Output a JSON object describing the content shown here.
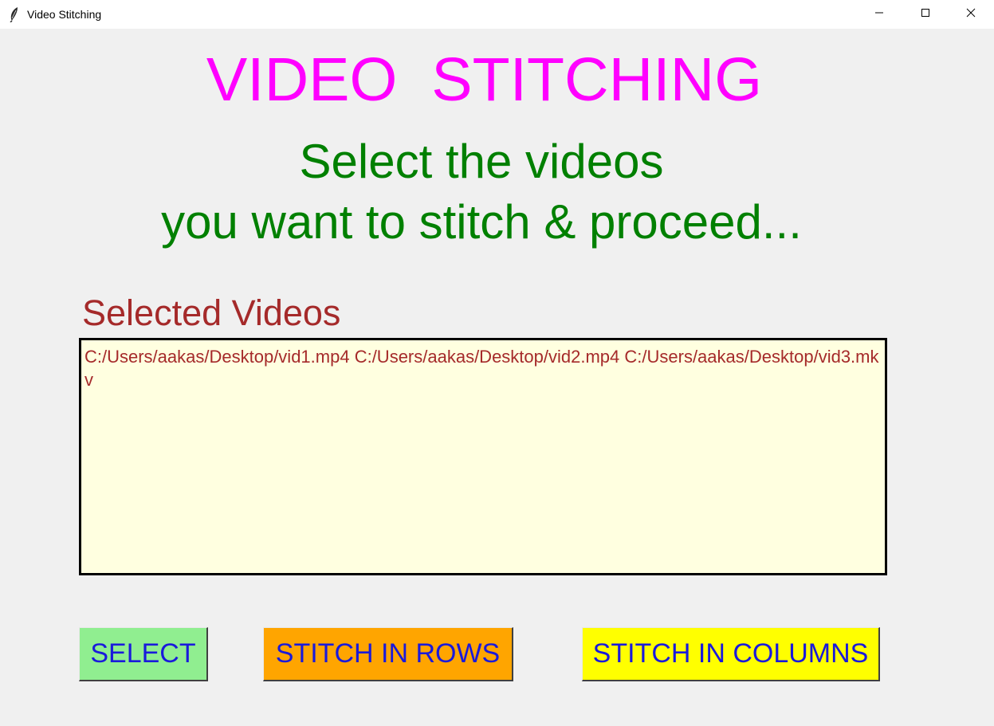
{
  "window": {
    "title": "Video Stitching",
    "controls": [
      "minimize-icon",
      "maximize-icon",
      "close-icon"
    ]
  },
  "main": {
    "heading": "VIDEO  STITCHING",
    "subtitle_line1": "Select the videos",
    "subtitle_line2": "you want to stitch & proceed...",
    "selected_label": "Selected Videos",
    "selected_videos_text": "C:/Users/aakas/Desktop/vid1.mp4 C:/Users/aakas/Desktop/vid2.mp4 C:/Users/aakas/Desktop/vid3.mkv"
  },
  "buttons": {
    "select_label": "SELECT",
    "stitch_rows_label": "STITCH IN ROWS",
    "stitch_columns_label": "STITCH IN COLUMNS"
  },
  "colors": {
    "heading": "#ff00ff",
    "subtitle": "#008000",
    "label": "#a52a2a",
    "textbox_bg": "#ffffe0",
    "button_text": "#1a1adb",
    "select_bg": "#90ee90",
    "rows_bg": "#ffa500",
    "columns_bg": "#ffff00"
  }
}
